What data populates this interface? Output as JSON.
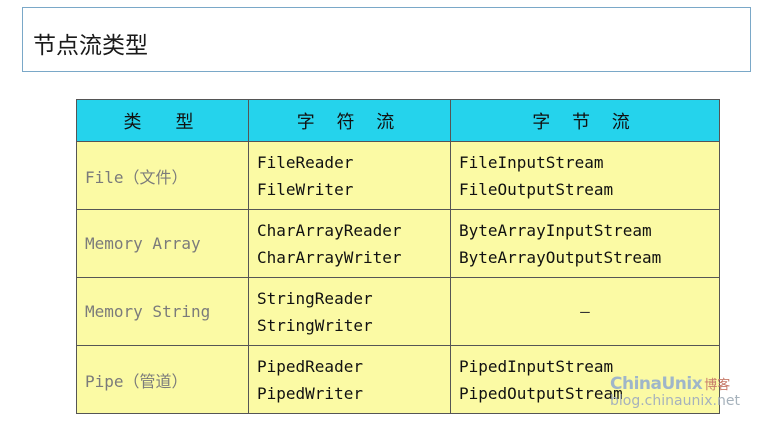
{
  "title": "节点流类型",
  "table": {
    "headers": [
      "类　型",
      "字 符 流",
      "字 节 流"
    ],
    "rows": [
      {
        "type": "File（文件）",
        "char": [
          "FileReader",
          "FileWriter"
        ],
        "byte": [
          "FileInputStream",
          "FileOutputStream"
        ]
      },
      {
        "type": "Memory Array",
        "char": [
          "CharArrayReader",
          "CharArrayWriter"
        ],
        "byte": [
          "ByteArrayInputStream",
          "ByteArrayOutputStream"
        ]
      },
      {
        "type": "Memory String",
        "char": [
          "StringReader",
          "StringWriter"
        ],
        "byte": [
          "—"
        ]
      },
      {
        "type": "Pipe（管道）",
        "char": [
          "PipedReader",
          "PipedWriter"
        ],
        "byte": [
          "PipedInputStream",
          "PipedOutputStream"
        ]
      }
    ]
  },
  "watermark": {
    "brand": "ChinaUnix",
    "brand_cn": "博客",
    "url": "blog.chinaunix.net"
  },
  "colors": {
    "header_bg": "#25d3ec",
    "cell_bg": "#fbfaa4",
    "type_text": "#7b7b7b"
  }
}
